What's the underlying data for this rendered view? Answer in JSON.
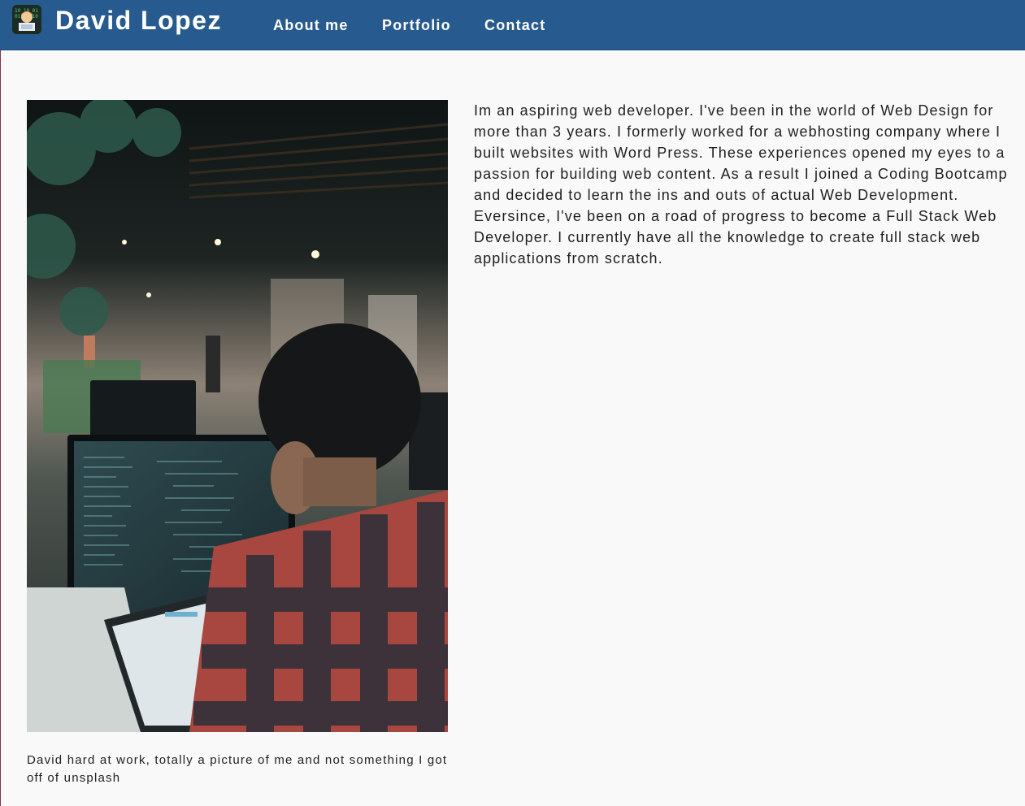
{
  "header": {
    "brand": "David Lopez",
    "logo_icon": "developer-avatar-icon",
    "background_color": "#275a8e",
    "nav": [
      {
        "label": "About me"
      },
      {
        "label": "Portfolio"
      },
      {
        "label": "Contact"
      }
    ]
  },
  "main": {
    "photo_icon": "developer-at-computer-photo",
    "caption": "David hard at work, totally a picture of me and not something I got off of unsplash",
    "bio": "Im an aspiring web developer. I've been in the world of Web Design for more than 3 years. I formerly worked for a webhosting company where I built websites with Word Press. These experiences opened my eyes to a passion for building web content. As a result I joined a Coding Bootcamp and decided to learn the ins and outs of actual Web Development. Eversince, I've been on a road of progress to become a Full Stack Web Developer. I currently have all the knowledge to create full stack web applications from scratch."
  }
}
